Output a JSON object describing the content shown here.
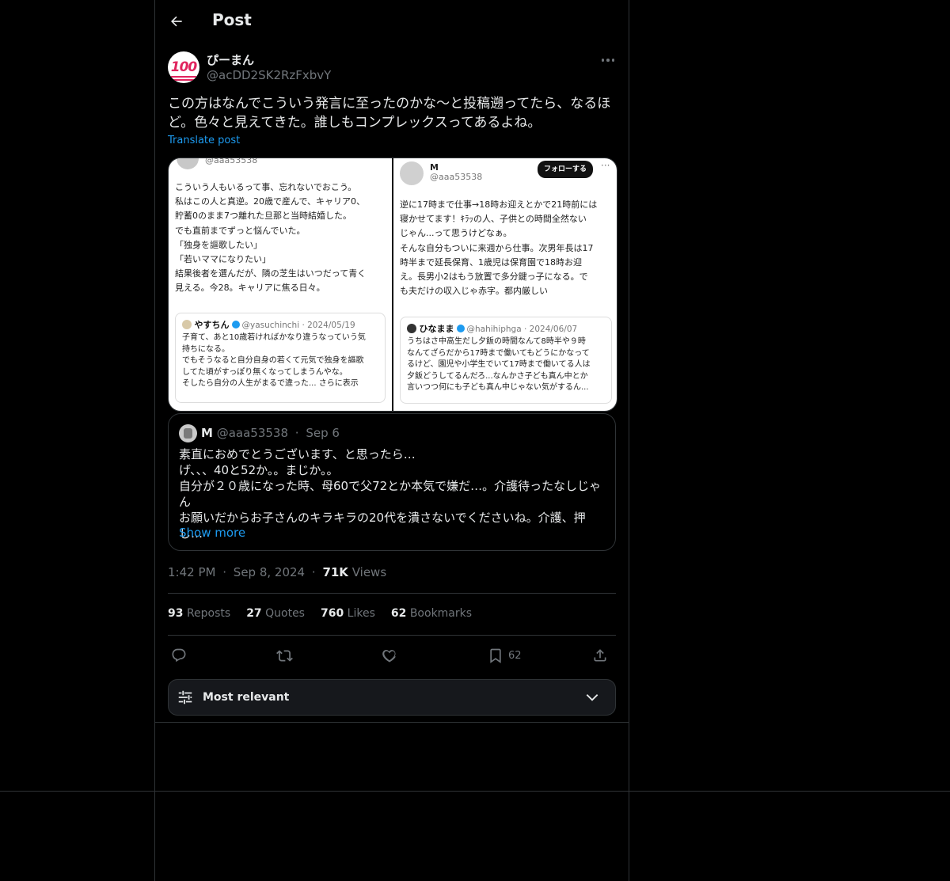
{
  "header": {
    "title": "Post"
  },
  "author": {
    "display_name": "ぴーまん",
    "handle": "@acDD2SK2RzFxbvY",
    "avatar_emoji": "💯"
  },
  "post": {
    "text": "この方はなんでこういう発言に至ったのかな〜と投稿遡ってたら、なるほど。色々と見えてきた。誰しもコンプレックスってあるよね。",
    "translate_label": "Translate post"
  },
  "media": {
    "left": {
      "handle": "@aaa53538",
      "body": "こういう人もいるって事、忘れないでおこう。\n私はこの人と真逆。20歳で産んで、キャリア0、\n貯蓄0のまま7つ離れた旦那と当時結婚した。\nでも直前までずっと悩んでいた。\n「独身を謳歌したい」\n「若いママになりたい」\n結果後者を選んだが、隣の芝生はいつだって青く\n見える。今28。キャリアに焦る日々。",
      "quote_name": "やすちん",
      "quote_meta": "@yasuchinchi · 2024/05/19",
      "quote_text": "子育て、あと10歳若ければかなり違うなっていう気\n持ちになる。\nでもそうなると自分自身の若くて元気で独身を謳歌\nしてた頃がすっぽり無くなってしまうんやな。\nそしたら自分の人生がまるで違った... さらに表示"
    },
    "right": {
      "name": "M",
      "handle": "@aaa53538",
      "follow_label": "フォローする",
      "body": "逆に17時まで仕事→18時お迎えとかで21時前には\n寝かせてます！ｷﾗｯの人、子供との時間全然ない\nじゃん...って思うけどなぁ。\nそんな自分もついに来週から仕事。次男年長は17\n時半まで延長保育、1歳児は保育園で18時お迎\nえ。長男小2はもう放置で多分鍵っ子になる。で\nも夫だけの収入じゃ赤字。都内厳しい",
      "quote_name": "ひなまま",
      "quote_meta": "@hahihiphga · 2024/06/07",
      "quote_text": "うちはさ中高生だし夕飯の時間なんて8時半や９時\nなんてざらだから17時まで働いてもどうにかなって\nるけど、園児や小学生でいて17時まで働いてる人は\n夕飯どうしてるんだろ...なんかさ子ども真ん中とか\n言いつつ何にも子ども真ん中じゃない気がするん..."
    }
  },
  "quote": {
    "name": "M",
    "handle": "@aaa53538",
    "sep": "·",
    "date": "Sep 6",
    "text": "素直におめでとうございます、と思ったら…\nげ、、、40と52か。。まじか。。\n自分が２０歳になった時、母60で父72とか本気で嫌だ…。介護待ったなしじゃん\nお願いだからお子さんのキラキラの20代を潰さないでくださいね。介護、押し…",
    "show_more": "Show more"
  },
  "meta": {
    "time": "1:42 PM",
    "sep": "·",
    "date": "Sep 8, 2024",
    "views_count": "71K",
    "views_label": "Views"
  },
  "stats": {
    "reposts_count": "93",
    "reposts_label": "Reposts",
    "quotes_count": "27",
    "quotes_label": "Quotes",
    "likes_count": "760",
    "likes_label": "Likes",
    "bookmarks_count": "62",
    "bookmarks_label": "Bookmarks"
  },
  "actions": {
    "bookmark_count": "62"
  },
  "icons": [
    "back-arrow-icon",
    "more-icon",
    "reply-icon",
    "repost-icon",
    "like-icon",
    "bookmark-icon",
    "share-icon",
    "sliders-icon",
    "chevron-down-icon"
  ],
  "sort": {
    "label": "Most relevant"
  },
  "colors": {
    "accent": "#1d9bf0",
    "text": "#e7e9ea",
    "muted": "#71767b",
    "border": "#2f3336",
    "background": "#000000"
  }
}
